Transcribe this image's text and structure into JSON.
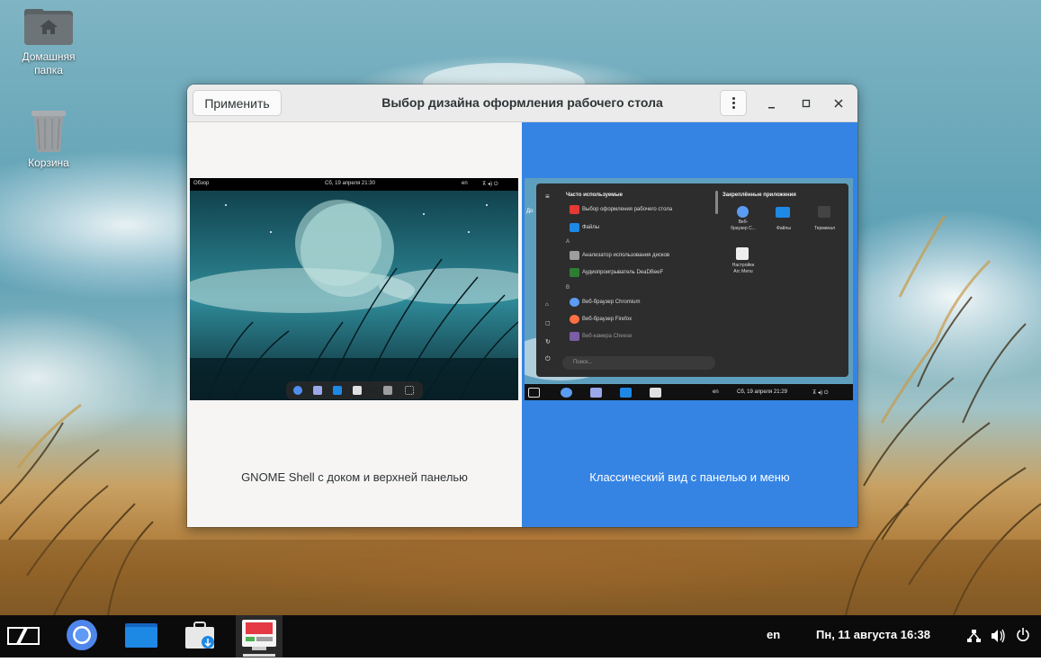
{
  "desktop": {
    "icons": [
      {
        "label": "Домашняя папка",
        "icon": "home-folder-icon"
      },
      {
        "label": "Корзина",
        "icon": "trash-icon"
      }
    ]
  },
  "window": {
    "title": "Выбор дизайна оформления рабочего стола",
    "apply_label": "Применить",
    "options": [
      {
        "caption": "GNOME Shell с доком и верхней панелью",
        "selected": false,
        "preview": {
          "overview": "Обзор",
          "datetime": "Сб, 19 апреля  21:30",
          "lang": "en"
        }
      },
      {
        "caption": "Классический вид с панелью и меню",
        "selected": true,
        "preview": {
          "frequent_header": "Часто используемые",
          "pinned_header": "Закреплённые приложения",
          "frequent_items": [
            "Выбор оформления рабочего стола",
            "Файлы"
          ],
          "section_a": "А",
          "a_items": [
            "Анализатор использования дисков",
            "Аудиопроигрыватель DeaDBeeF"
          ],
          "section_b": "В",
          "b_items": [
            "Веб-браузер Chromium",
            "Веб-браузер Firefox",
            "Веб-камера Cheese"
          ],
          "pinned": [
            "Веб-браузер C...",
            "Файлы",
            "Терминал",
            "Настройки Arc Menu"
          ],
          "pinned_browser_line1": "Веб-",
          "pinned_browser_line2": "браузер C...",
          "pinned_settings_line1": "Настройки",
          "pinned_settings_line2": "Arc Menu",
          "search_placeholder": "Поиск...",
          "lang": "en",
          "datetime": "Сб, 19 апреля  21:29",
          "wallpaper_fragment": "До"
        }
      }
    ],
    "accent_color": "#3584e4"
  },
  "taskbar": {
    "lang": "en",
    "datetime": "Пн, 11 августа  16:38",
    "apps": [
      "menu-logo-icon",
      "chromium-icon",
      "files-icon",
      "software-installer-icon",
      "desktop-design-icon"
    ]
  }
}
